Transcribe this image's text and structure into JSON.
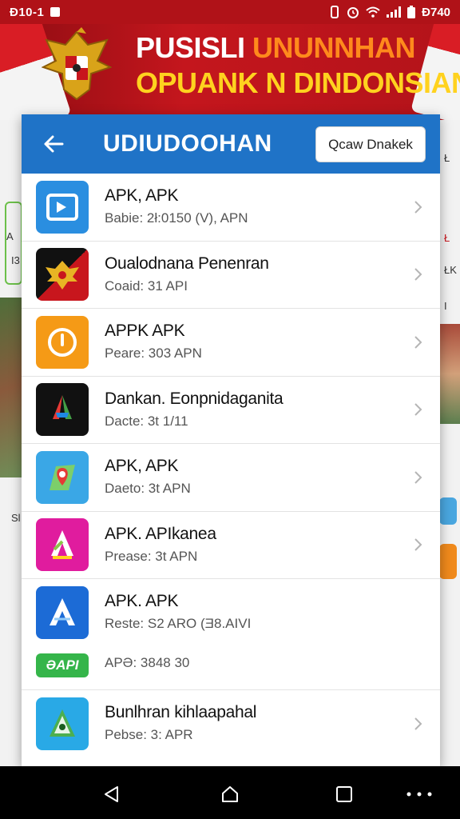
{
  "status_bar": {
    "time": "Đ10-1",
    "right_text": "Đ740"
  },
  "banner": {
    "line1_white": "PUSISLI ",
    "line1_orange": "UNUNNHAN",
    "line2": "OPUANK N DINDONSIAN"
  },
  "dialog": {
    "title": "UDIUDOOHAN",
    "header_button": "Qcaw Dnakek",
    "apps": [
      {
        "name": "APK, APK",
        "meta": "Babie: 2ł:0150 (V), APN",
        "icon": "blue-folder-icon",
        "color": "#2a8ee0"
      },
      {
        "name": "Oualodnana Penenran",
        "meta": "Coaid: 31 API",
        "icon": "garuda-emblem-icon",
        "color": "#c8161d"
      },
      {
        "name": "APPK APK",
        "meta": "Peare: 303 APN",
        "icon": "orange-circle-icon",
        "color": "#f59a16"
      },
      {
        "name": "Dankan. Eonpnidaganita",
        "meta": "Dacte: 3t 1/11",
        "icon": "prism-a-icon",
        "color": "#111111"
      },
      {
        "name": "APK, APK",
        "meta": "Daeto: 3t APN",
        "icon": "map-pin-icon",
        "color": "#3aa7e6"
      },
      {
        "name": "APK. APIkanea",
        "meta": "Prease: 3t APN",
        "icon": "magenta-a-icon",
        "color": "#e01c9e"
      },
      {
        "name": "APK. APK",
        "meta": "Reste: S2 ARO (Ǝ8.AIVI",
        "icon": "blue-a-icon",
        "color": "#1c6bd6"
      }
    ],
    "pill_row": {
      "pill": "ƏAPI",
      "text": "APƏ: 3848 30"
    },
    "last_app": {
      "name": "Bunlhran kihlaapahal",
      "meta": "Pebse: 3: APR",
      "icon": "green-map-icon",
      "color": "#29a9e6"
    }
  },
  "background": {
    "left_labels": [
      "A",
      "I3",
      "Sl"
    ],
    "right_labels": [
      "Ł",
      "Ł",
      "ŁK",
      "I"
    ]
  },
  "nav": {
    "back": "back-icon",
    "home": "home-icon",
    "recents": "recents-icon",
    "more": "more-icon"
  }
}
